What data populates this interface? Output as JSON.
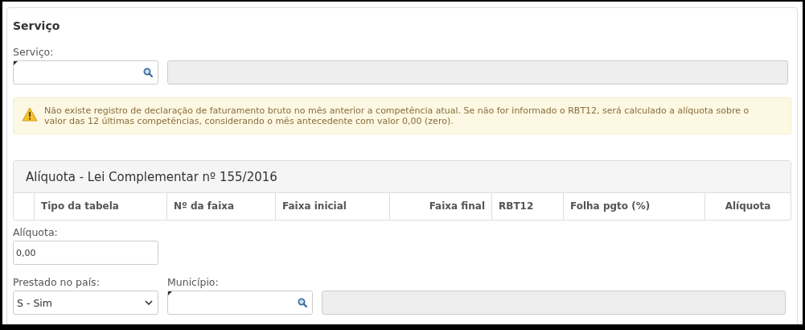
{
  "section": {
    "title": "Serviço"
  },
  "service": {
    "label": "Serviço:"
  },
  "alert": {
    "text": "Não existe registro de declaração de faturamento bruto no mês anterior a competência atual. Se não for informado o RBT12, será calculado a alíquota sobre o valor das 12 últimas competências, considerando o mês antecedente com valor 0,00 (zero)."
  },
  "table": {
    "title": "Alíquota - Lei Complementar nº 155/2016",
    "columns": [
      {
        "label": "Tipo da tabela",
        "kind": "text"
      },
      {
        "label": "Nº da faixa",
        "kind": "text"
      },
      {
        "label": "Faixa inicial",
        "kind": "text"
      },
      {
        "label": "Faixa final",
        "kind": "number"
      },
      {
        "label": "RBT12",
        "kind": "text"
      },
      {
        "label": "Folha pgto (%)",
        "kind": "text"
      },
      {
        "label": "Alíquota",
        "kind": "rate"
      }
    ]
  },
  "rate": {
    "label": "Alíquota:",
    "value": "0,00"
  },
  "country": {
    "label": "Prestado no país:",
    "value": "S - Sim"
  },
  "city": {
    "label": "Município:"
  }
}
